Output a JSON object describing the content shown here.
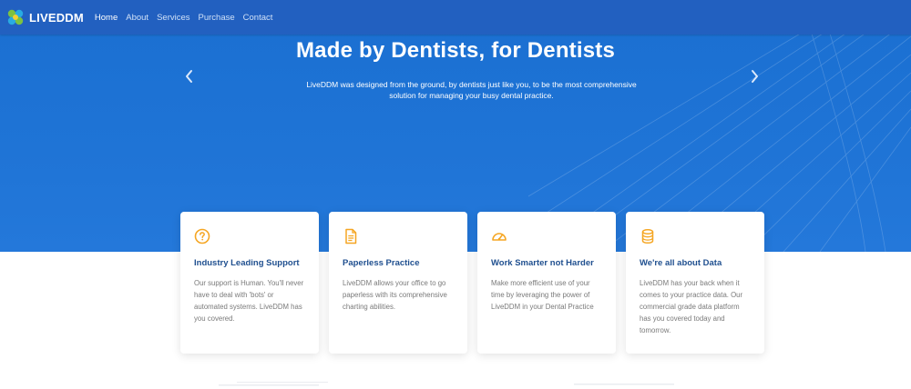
{
  "colors": {
    "accent": "#f5a623",
    "brand": "#1f74d6",
    "title": "#1f4f8f"
  },
  "brand": {
    "name": "LIVEDDM"
  },
  "nav": {
    "items": [
      {
        "label": "Home",
        "active": true
      },
      {
        "label": "About",
        "active": false
      },
      {
        "label": "Services",
        "active": false
      },
      {
        "label": "Purchase",
        "active": false
      },
      {
        "label": "Contact",
        "active": false
      }
    ]
  },
  "hero": {
    "title": "Made by Dentists, for Dentists",
    "subtitle": "LiveDDM was designed from the ground, by dentists just like you, to be the most comprehensive solution for managing your busy dental practice.",
    "prev_icon": "chevron-left-icon",
    "next_icon": "chevron-right-icon"
  },
  "features": [
    {
      "icon": "question-circle-icon",
      "title": "Industry Leading Support",
      "text": "Our support is Human. You'll never have to deal with 'bots' or automated systems. LiveDDM has you covered."
    },
    {
      "icon": "document-icon",
      "title": "Paperless Practice",
      "text": "LiveDDM allows your office to go paperless with its comprehensive charting abilities."
    },
    {
      "icon": "gauge-icon",
      "title": "Work Smarter not Harder",
      "text": "Make more efficient use of your time by leveraging the power of LiveDDM in your Dental Practice"
    },
    {
      "icon": "database-icon",
      "title": "We're all about Data",
      "text": "LiveDDM has your back when it comes to your practice data. Our commercial grade data platform has you covered today and tomorrow."
    }
  ]
}
